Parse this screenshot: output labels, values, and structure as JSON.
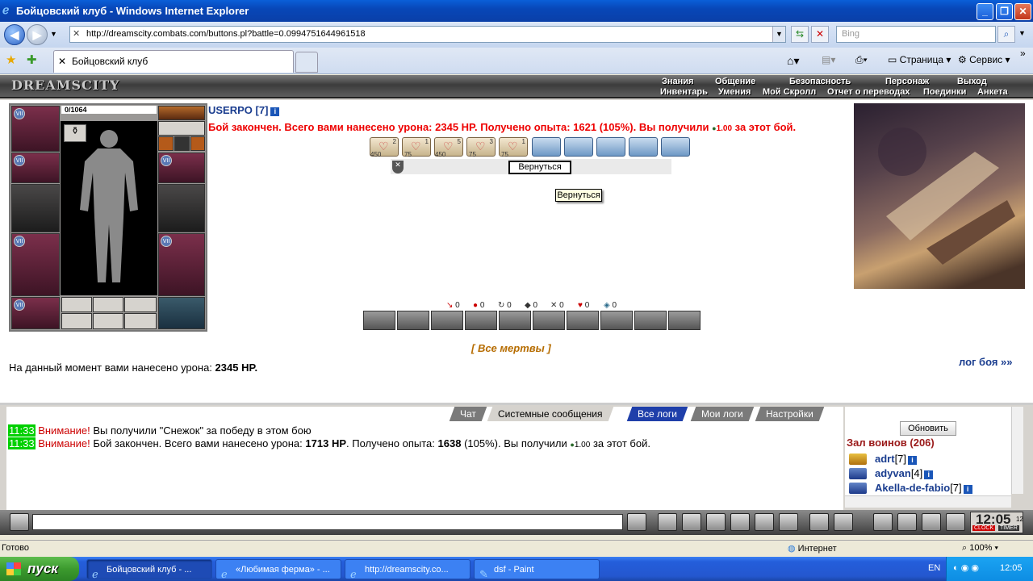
{
  "window": {
    "title": "Бойцовский клуб - Windows Internet Explorer"
  },
  "browser": {
    "url": "http://dreamscity.combats.com/buttons.pl?battle=0.0994751644961518",
    "search_placeholder": "Bing",
    "tab_title": "Бойцовский клуб",
    "cmd_page": "Страница",
    "cmd_service": "Сервис"
  },
  "game": {
    "logo": "DREAMSCITY",
    "nav_top": [
      "Знания",
      "Общение",
      "Безопасность",
      "Персонаж",
      "Выход"
    ],
    "nav_bottom": [
      "Инвентарь",
      "Умения",
      "Мой Скролл",
      "Отчет о переводах",
      "Поединки",
      "Анкета"
    ],
    "hp": "0/1064",
    "username": "USERPO [7]",
    "info_icon": "i",
    "battle_msg": "Бой закончен. Всего вами нанесено урона: 2345 HP. Получено опыта: 1621 (105%). Вы получили",
    "battle_gem": "1.00",
    "battle_end": "за этот бой.",
    "scroll_counts": [
      {
        "top": "2",
        "bottom": "450"
      },
      {
        "top": "1",
        "bottom": "75"
      },
      {
        "top": "5",
        "bottom": "450"
      },
      {
        "top": "3",
        "bottom": "75"
      },
      {
        "top": "1",
        "bottom": "75"
      }
    ],
    "return_button": "Вернуться",
    "return_tooltip": "Вернуться",
    "stats": [
      "0",
      "0",
      "0",
      "0",
      "0",
      "0",
      "0"
    ],
    "all_dead": "[ Все мертвы ]",
    "damage_prefix": "На данный момент вами нанесено урона:",
    "damage_value": "2345 HP.",
    "log_link": "лог боя »»"
  },
  "chat": {
    "tabs": [
      "Чат",
      "Системные сообщения",
      "Все логи",
      "Мои логи",
      "Настройки"
    ],
    "lines": [
      {
        "time": "11:33",
        "warn": "Внимание!",
        "text": "Вы получили \"Снежок\" за победу в этом бою"
      },
      {
        "time": "11:33",
        "warn": "Внимание!",
        "text_a": "Бой закончен. Всего вами нанесено урона:",
        "b1": "1713 HP",
        "text_b": ". Получено опыта:",
        "b2": "1638",
        "text_c": "(105%). Вы получили",
        "gem": "1.00",
        "text_d": "за этот бой."
      }
    ]
  },
  "side": {
    "refresh": "Обновить",
    "hall": "Зал воинов (206)",
    "warriors": [
      {
        "name": "adrt",
        "level": "[7]"
      },
      {
        "name": "adyvan",
        "level": "[4]"
      },
      {
        "name": "Akella-de-fabio",
        "level": "[7]"
      }
    ]
  },
  "clock": {
    "time": "12:05",
    "sec": "12",
    "clock_label": "CLOCK",
    "timer_label": "TIMER"
  },
  "status": {
    "left": "Готово",
    "zone": "Интернет",
    "zoom": "100%"
  },
  "taskbar": {
    "start": "пуск",
    "tasks": [
      "Бойцовский клуб - ...",
      "«Любимая ферма» - ...",
      "http://dreamscity.co...",
      "dsf - Paint"
    ],
    "lang": "EN",
    "time": "12:05"
  }
}
